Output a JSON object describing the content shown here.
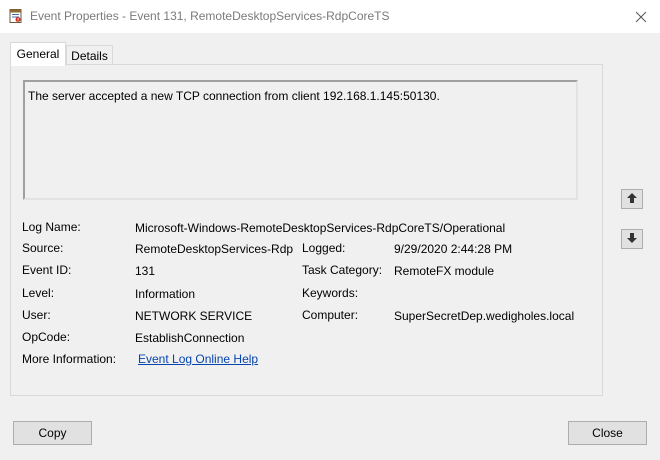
{
  "window": {
    "title": "Event Properties - Event 131, RemoteDesktopServices-RdpCoreTS",
    "icon": "event-viewer-icon",
    "close_icon": "close-icon"
  },
  "tabs": [
    {
      "label": "General",
      "selected": true
    },
    {
      "label": "Details",
      "selected": false
    }
  ],
  "description": "The server accepted a new TCP connection from client 192.168.1.145:50130.",
  "fields": {
    "log_name": {
      "label": "Log Name:",
      "value": "Microsoft-Windows-RemoteDesktopServices-RdpCoreTS/Operational"
    },
    "source": {
      "label": "Source:",
      "value": "RemoteDesktopServices-Rdp"
    },
    "logged": {
      "label": "Logged:",
      "value": "9/29/2020 2:44:28 PM"
    },
    "event_id": {
      "label": "Event ID:",
      "value": "131"
    },
    "task_category": {
      "label": "Task Category:",
      "value": "RemoteFX module"
    },
    "level": {
      "label": "Level:",
      "value": "Information"
    },
    "keywords": {
      "label": "Keywords:",
      "value": ""
    },
    "user": {
      "label": "User:",
      "value": "NETWORK SERVICE"
    },
    "computer": {
      "label": "Computer:",
      "value": "SuperSecretDep.wedigholes.local"
    },
    "opcode": {
      "label": "OpCode:",
      "value": "EstablishConnection"
    },
    "more_info": {
      "label": "More Information:",
      "value": "Event Log Online Help"
    }
  },
  "navigation": {
    "up_icon": "arrow-up-icon",
    "down_icon": "arrow-down-icon"
  },
  "buttons": {
    "copy": "Copy",
    "close": "Close"
  },
  "colors": {
    "link": "#0645ad",
    "window_bg": "#f0f0f0",
    "titlebar_bg": "#ffffff"
  }
}
